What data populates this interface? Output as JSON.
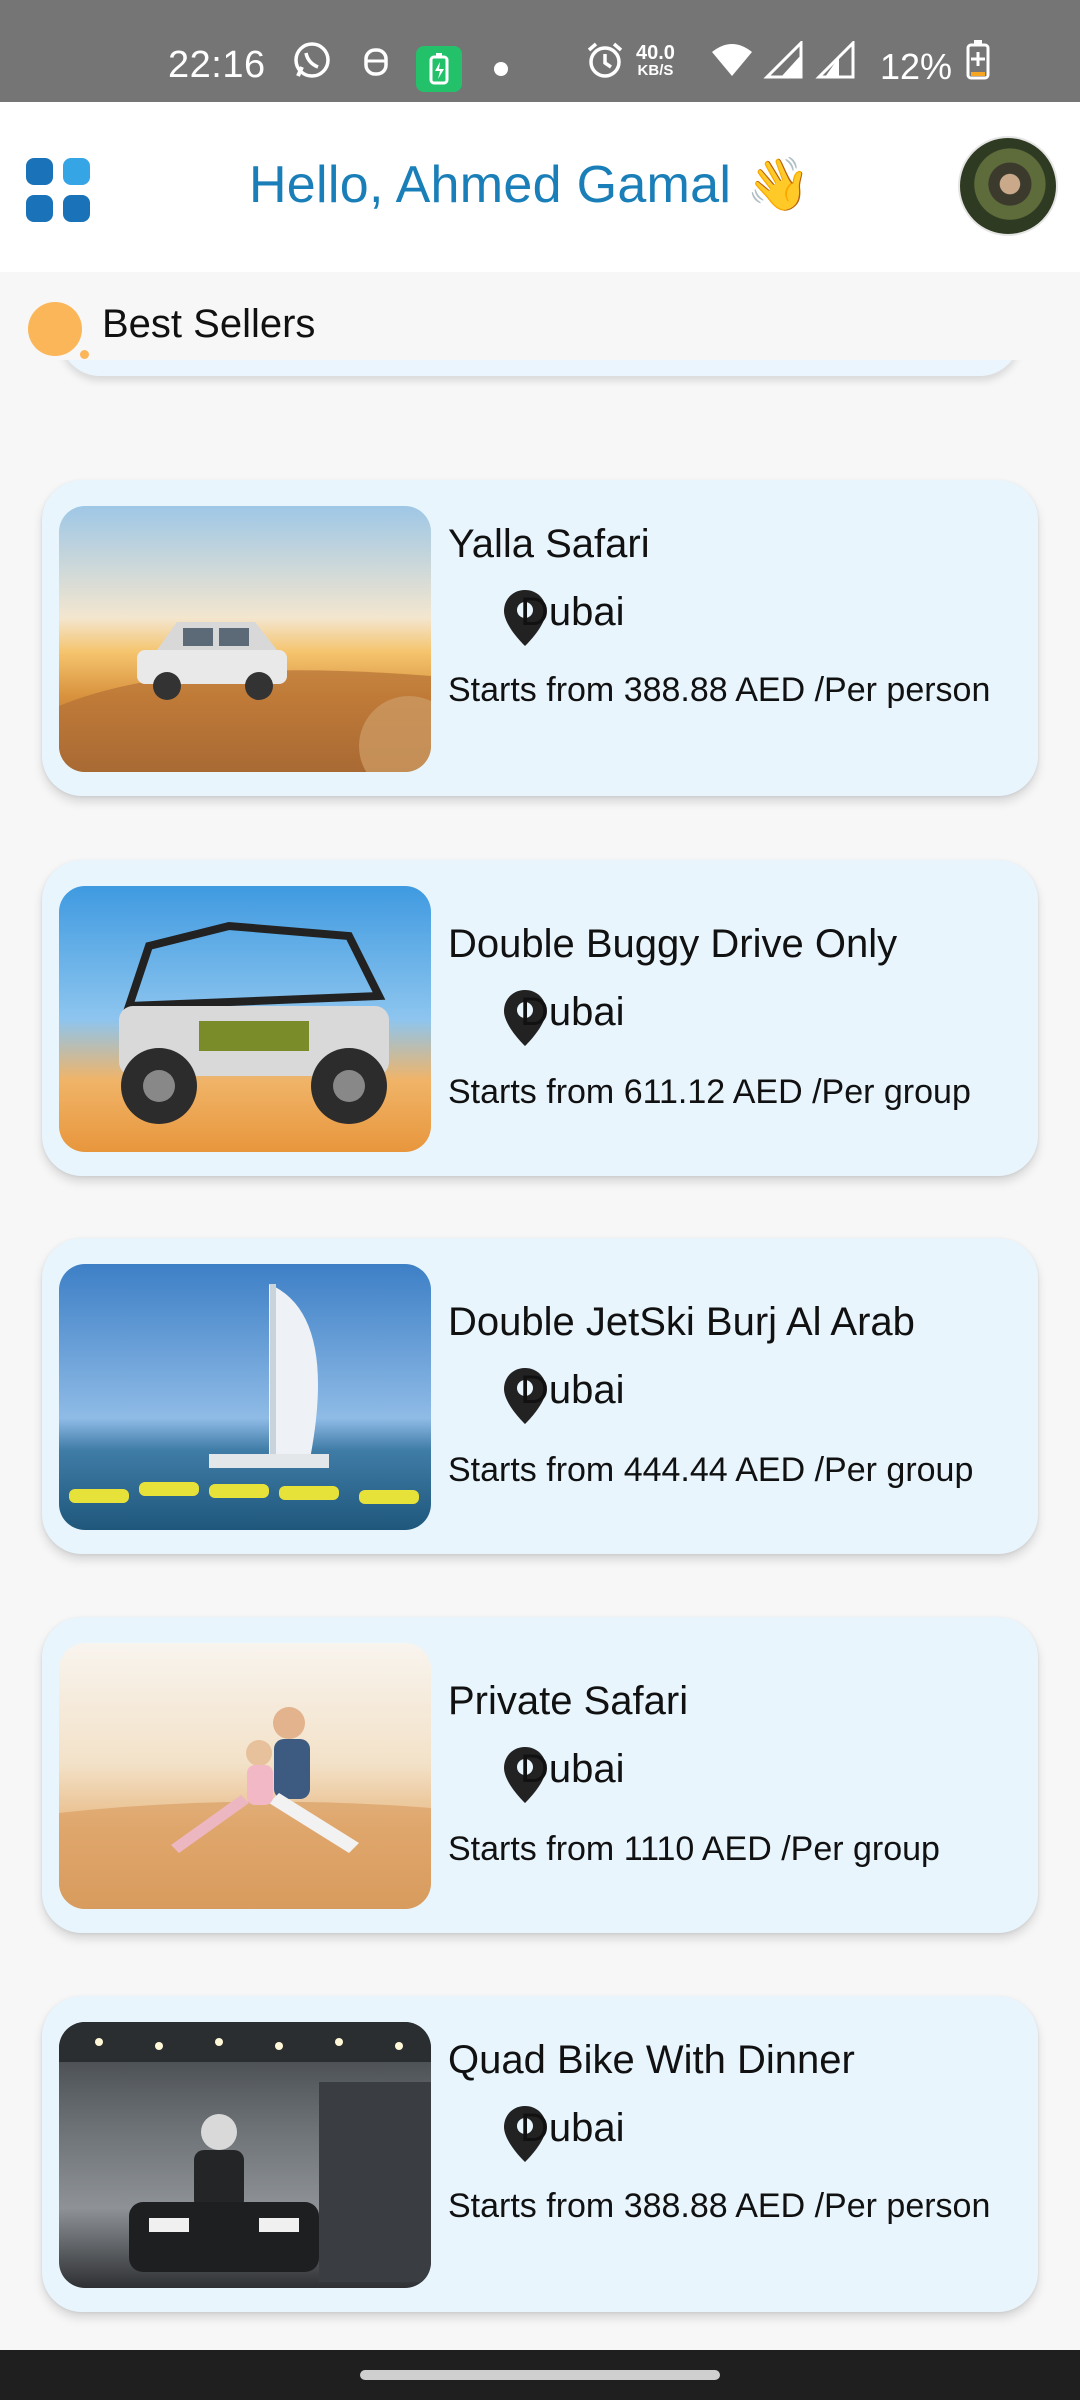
{
  "status_bar": {
    "time": "22:16",
    "net_speed_value": "40.0",
    "net_speed_unit": "KB/S",
    "battery_percent": "12%"
  },
  "header": {
    "greeting": "Hello, Ahmed Gamal 👋"
  },
  "section": {
    "title": "Best Sellers"
  },
  "listings": [
    {
      "title": "Yalla Safari",
      "location": "Dubai",
      "price": "Starts from 388.88 AED /Per person"
    },
    {
      "title": "Double Buggy Drive Only",
      "location": "Dubai",
      "price": "Starts from 611.12 AED /Per group"
    },
    {
      "title": "Double JetSki Burj Al Arab",
      "location": "Dubai",
      "price": "Starts from 444.44 AED /Per group"
    },
    {
      "title": "Private Safari",
      "location": "Dubai",
      "price": "Starts from 1110 AED /Per group"
    },
    {
      "title": "Quad Bike With Dinner",
      "location": "Dubai",
      "price": "Starts from 388.88 AED /Per person"
    }
  ],
  "colors": {
    "accent_blue": "#1a7fb8",
    "card_bg": "#e8f5fd",
    "section_marker": "#fbb65a"
  },
  "icons": {
    "menu": "grid-menu-icon",
    "location": "map-pin-icon"
  }
}
